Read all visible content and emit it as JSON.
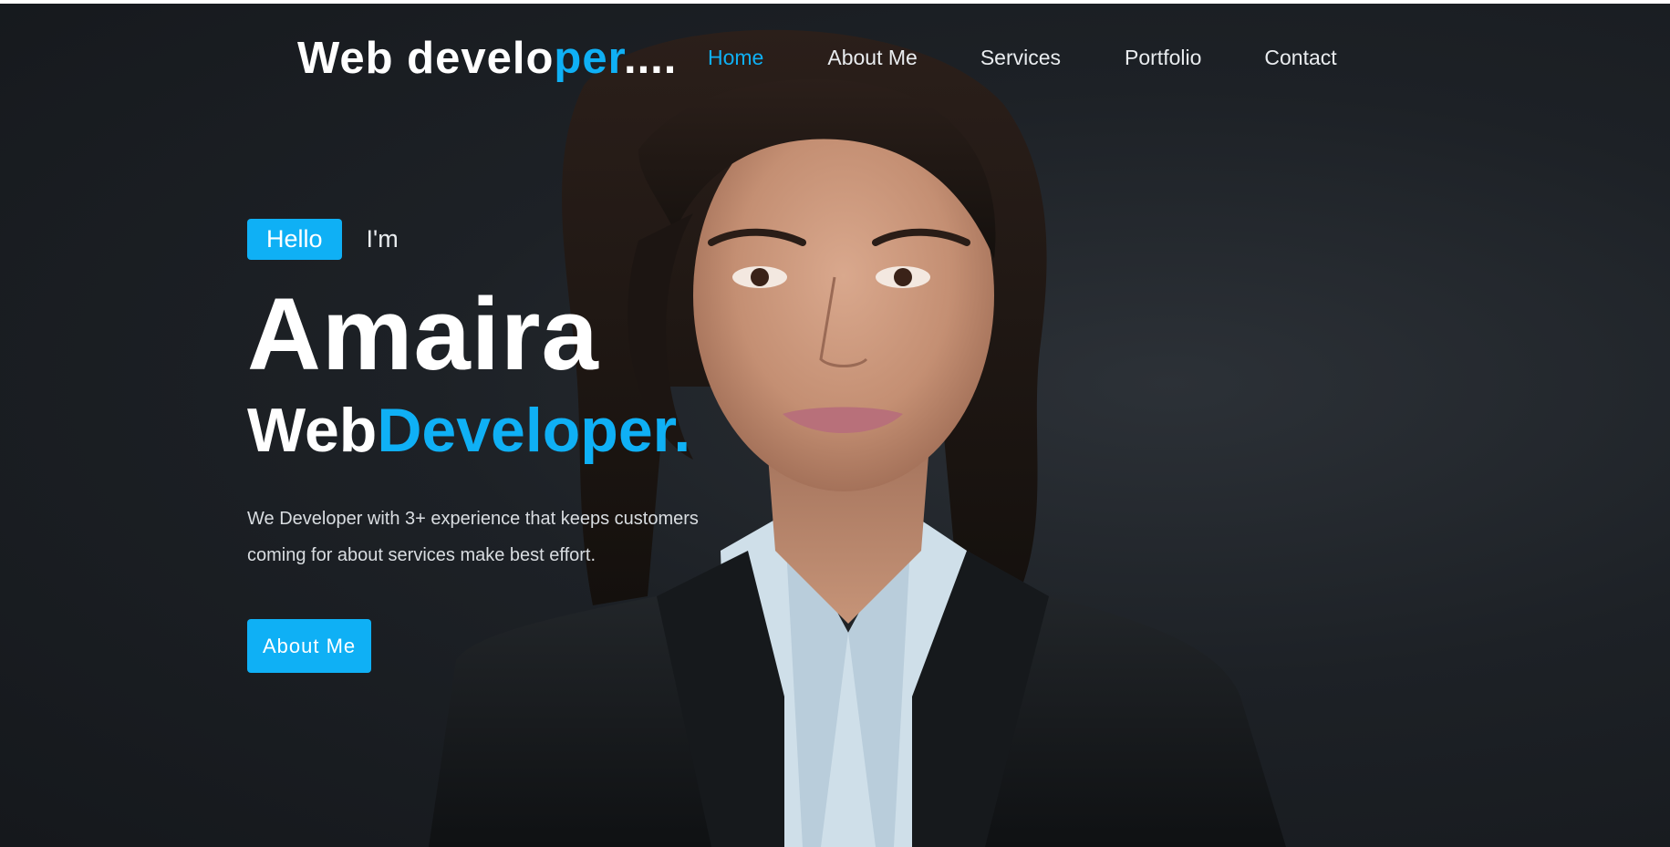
{
  "header": {
    "logo_main": "Web develo",
    "logo_accent": "per",
    "logo_suffix": "....",
    "nav": [
      {
        "label": "Home",
        "active": true
      },
      {
        "label": "About Me",
        "active": false
      },
      {
        "label": "Services",
        "active": false
      },
      {
        "label": "Portfolio",
        "active": false
      },
      {
        "label": "Contact",
        "active": false
      }
    ]
  },
  "hero": {
    "hello_label": "Hello",
    "im_label": "I'm",
    "name": "Amaira",
    "role_first": "Web",
    "role_second": "Developer.",
    "description": "We Developer with 3+ experience that keeps customers coming for about services make best effort.",
    "cta_label": "About Me"
  },
  "colors": {
    "accent": "#0fb0f5",
    "background": "#1d2126",
    "text": "#ffffff"
  },
  "icons": []
}
